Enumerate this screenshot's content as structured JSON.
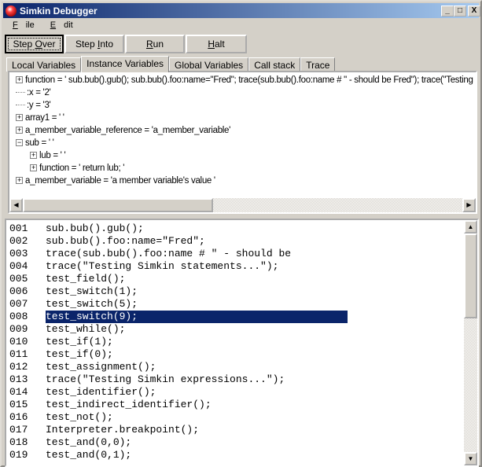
{
  "window": {
    "title": "Simkin Debugger",
    "minimize": "_",
    "maximize": "□",
    "close": "X"
  },
  "menu": [
    {
      "label": "File",
      "accel": "F",
      "rest": "ile"
    },
    {
      "label": "Edit",
      "accel": "E",
      "rest": "dit"
    }
  ],
  "toolbar": [
    {
      "pre": "Step ",
      "accel": "O",
      "post": "ver"
    },
    {
      "pre": "Step ",
      "accel": "I",
      "post": "nto"
    },
    {
      "pre": "",
      "accel": "R",
      "post": "un"
    },
    {
      "pre": "",
      "accel": "H",
      "post": "alt"
    }
  ],
  "tabs": [
    "Local Variables",
    "Instance Variables",
    "Global Variables",
    "Call stack",
    "Trace"
  ],
  "active_tab": "Instance Variables",
  "tree": [
    {
      "text": "function = ' sub.bub().gub(); sub.bub().foo:name=\"Fred\"; trace(sub.bub().foo:name # \" - should be Fred\"); trace(\"Testing S",
      "expander": "+",
      "level": 0
    },
    {
      "text": ":x = '2'",
      "expander": "",
      "level": 0
    },
    {
      "text": ":y = '3'",
      "expander": "",
      "level": 0
    },
    {
      "text": "array1 = '     '",
      "expander": "+",
      "level": 0
    },
    {
      "text": "a_member_variable_reference = 'a_member_variable'",
      "expander": "+",
      "level": 0
    },
    {
      "text": "sub = '   '",
      "expander": "−",
      "level": 0
    },
    {
      "text": "lub = '   '",
      "expander": "+",
      "level": 1
    },
    {
      "text": "function = '  return lub; '",
      "expander": "+",
      "level": 1
    },
    {
      "text": "a_member_variable = 'a member variable's value '",
      "expander": "+",
      "level": 0
    }
  ],
  "code": [
    {
      "n": "001",
      "t": "sub.bub().gub();"
    },
    {
      "n": "002",
      "t": "sub.bub().foo:name=\"Fred\";"
    },
    {
      "n": "003",
      "t": "trace(sub.bub().foo:name # \" - should be"
    },
    {
      "n": "004",
      "t": "trace(\"Testing Simkin statements...\");"
    },
    {
      "n": "005",
      "t": "test_field();"
    },
    {
      "n": "006",
      "t": "test_switch(1);"
    },
    {
      "n": "007",
      "t": "test_switch(5);"
    },
    {
      "n": "008",
      "t": "test_switch(9);"
    },
    {
      "n": "009",
      "t": "test_while();"
    },
    {
      "n": "010",
      "t": "test_if(1);"
    },
    {
      "n": "011",
      "t": "test_if(0);"
    },
    {
      "n": "012",
      "t": "test_assignment();"
    },
    {
      "n": "013",
      "t": "trace(\"Testing Simkin expressions...\");"
    },
    {
      "n": "014",
      "t": "test_identifier();"
    },
    {
      "n": "015",
      "t": "test_indirect_identifier();"
    },
    {
      "n": "016",
      "t": "test_not();"
    },
    {
      "n": "017",
      "t": "Interpreter.breakpoint();"
    },
    {
      "n": "018",
      "t": "test_and(0,0);"
    },
    {
      "n": "019",
      "t": "test_and(0,1);"
    }
  ],
  "current_line": "008",
  "colors": {
    "titlebar_start": "#0a246a",
    "titlebar_end": "#a6caf0",
    "highlight": "#0a246a"
  }
}
